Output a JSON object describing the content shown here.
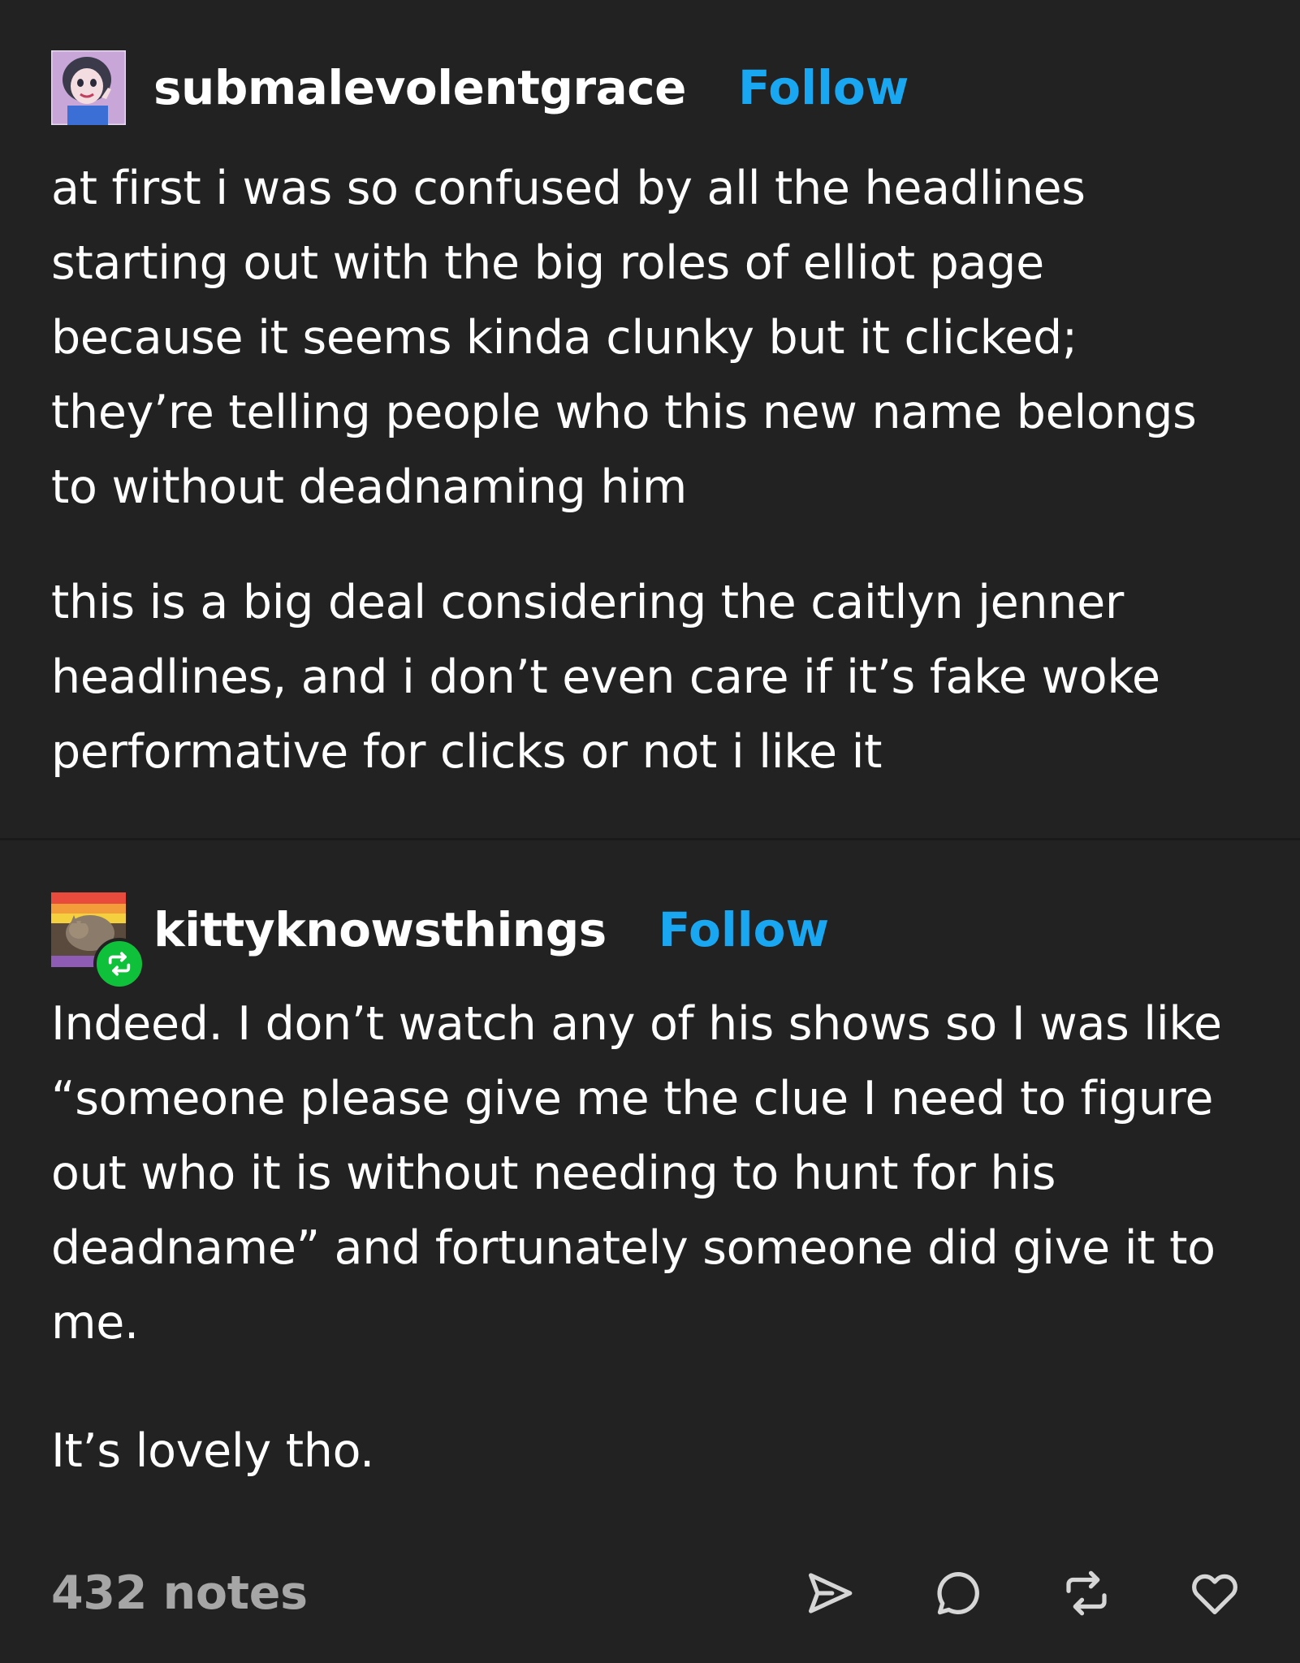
{
  "post_1": {
    "username": "submalevolentgrace",
    "follow_label": "Follow",
    "paragraphs": [
      "at first i was so confused by all the headlines starting out with the big roles of elliot page because it seems kinda clunky but it clicked; they’re telling people who this new name belongs to without deadnaming him",
      "this is a big deal considering the caitlyn jenner headlines, and i don’t even care if it’s fake woke performative for clicks or not i like it"
    ]
  },
  "post_2": {
    "username": "kittyknowsthings",
    "follow_label": "Follow",
    "badge_icon": "reblog-icon",
    "paragraphs": [
      "Indeed. I don’t watch any of his shows so I was like “someone please give me the clue I need to figure out who it is without needing to hunt for his deadname” and fortunately someone did give it to me.",
      "It’s lovely tho."
    ]
  },
  "footer": {
    "notes": "432 notes",
    "actions": [
      "share-icon",
      "reply-icon",
      "reblog-icon",
      "like-icon"
    ]
  },
  "colors": {
    "background": "#222222",
    "follow": "#1aa7f2",
    "reblog_badge": "#0fc13a",
    "notes": "#a6a6a6"
  }
}
